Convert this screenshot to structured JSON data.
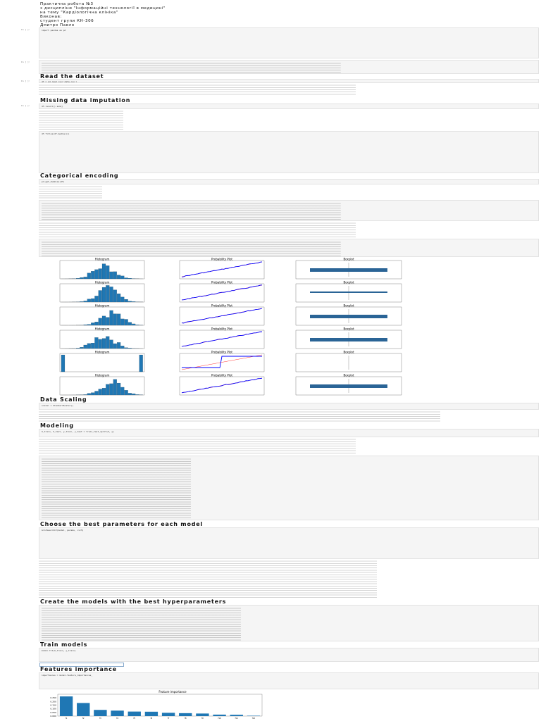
{
  "header": {
    "lines": [
      "Практична робота №3",
      "з дисципліни \"Інформаційні технології в медицині\"",
      "на тему \"Кардіологічна клініка\"",
      "Виконав:",
      "студент групи КН-30б",
      "Дмитро Павло"
    ]
  },
  "prompt": "In [ ]:",
  "headings": [
    "Read the dataset",
    "Missing data imputation",
    "Categorical encoding",
    "Data Scaling",
    "Modeling",
    "Choose the best parameters for each model",
    "Create the models with the best hyperparameters",
    "Train models",
    "Features importance"
  ],
  "code": {
    "import": "import pandas as pd",
    "read": "df = pd.read_csv('data.csv')",
    "head": "df.head()",
    "isna": "df.isnull().sum()",
    "fill": "df.fillna(df.median())",
    "encode": "pd.get_dummies(df)",
    "scale": "scaler = StandardScaler()",
    "split": "X_train, X_test, y_train, y_test = train_test_split(X, y)",
    "grid": "GridSearchCV(model, params, cv=5)",
    "fit": "model.fit(X_train, y_train)",
    "imp": "importances = model.feature_importances_"
  },
  "plots": {
    "hist_title": "Histogram",
    "prob_title": "Probability Plot",
    "box_title": "Boxplot"
  },
  "chart_data": {
    "type": "bar",
    "title": "Feature importance",
    "categories": [
      "f1",
      "f2",
      "f3",
      "f4",
      "f5",
      "f6",
      "f7",
      "f8",
      "f9",
      "f10",
      "f11",
      "f12"
    ],
    "values": [
      0.27,
      0.18,
      0.085,
      0.075,
      0.062,
      0.06,
      0.045,
      0.04,
      0.035,
      0.02,
      0.018,
      0.005
    ],
    "ylim": [
      0,
      0.3
    ],
    "yticks": [
      "0.000",
      "0.050",
      "0.100",
      "0.150",
      "0.200",
      "0.250"
    ]
  },
  "colors": {
    "bar": "#1f77b4",
    "prob": "#0000ff",
    "fit": "#ff0000"
  }
}
